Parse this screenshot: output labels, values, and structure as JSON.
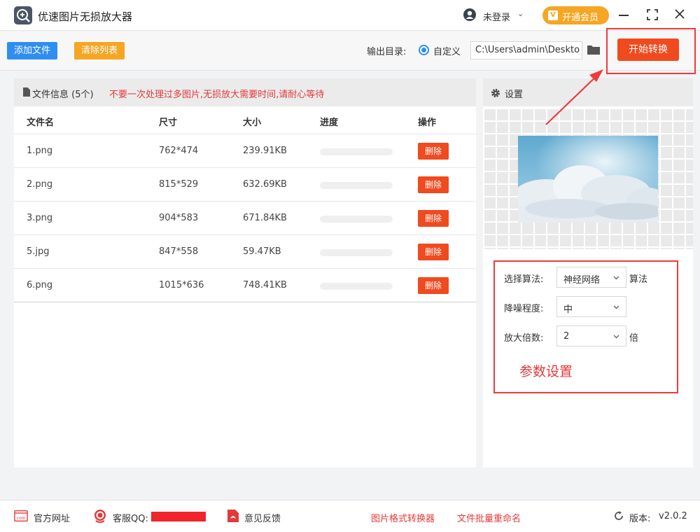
{
  "app": {
    "title": "优速图片无损放大器",
    "login_label": "未登录",
    "vip_label": "开通会员",
    "vip_badge": "V"
  },
  "toolbar": {
    "add_label": "添加文件",
    "clear_label": "清除列表",
    "output_label": "输出目录:",
    "radio_label": "自定义",
    "output_path": "C:\\Users\\admin\\Deskto",
    "start_label": "开始转换"
  },
  "files": {
    "info_label": "文件信息 (5个)",
    "warning": "不要一次处理过多图片,无损放大需要时间,请耐心等待",
    "columns": [
      "文件名",
      "尺寸",
      "大小",
      "进度",
      "操作"
    ],
    "rows": [
      {
        "name": "1.png",
        "size": "762*474",
        "bytes": "239.91KB",
        "progress": 0,
        "action": "删除"
      },
      {
        "name": "2.png",
        "size": "815*529",
        "bytes": "632.69KB",
        "progress": 0,
        "action": "删除"
      },
      {
        "name": "3.png",
        "size": "904*583",
        "bytes": "671.84KB",
        "progress": 0,
        "action": "删除"
      },
      {
        "name": "5.jpg",
        "size": "847*558",
        "bytes": "59.47KB",
        "progress": 0,
        "action": "删除"
      },
      {
        "name": "6.png",
        "size": "1015*636",
        "bytes": "748.41KB",
        "progress": 0,
        "action": "删除"
      }
    ]
  },
  "settings": {
    "title": "设置",
    "algorithm_label": "选择算法:",
    "algorithm_value": "神经网络",
    "algorithm_suffix": "算法",
    "denoise_label": "降噪程度:",
    "denoise_value": "中",
    "scale_label": "放大倍数:",
    "scale_value": "2",
    "scale_suffix": "倍",
    "note": "参数设置"
  },
  "footer": {
    "website": "官方网址",
    "qq": "客服QQ:",
    "feedback": "意见反馈",
    "converter": "图片格式转换器",
    "rename": "文件批量重命名",
    "version_label": "版本:",
    "version": "v2.0.2",
    "web_icon_text": "com"
  },
  "colors": {
    "primary": "#2f8ef0",
    "orange": "#f5a623",
    "danger": "#f04a1f",
    "annotation": "#f03a3a"
  },
  "icons": [
    "app-logo-icon",
    "user-icon",
    "vip-icon",
    "minimize-icon",
    "maximize-icon",
    "close-icon",
    "folder-icon",
    "document-icon",
    "gear-icon",
    "chevron-down-icon",
    "website-icon",
    "qq-icon",
    "pdf-icon",
    "refresh-icon"
  ]
}
